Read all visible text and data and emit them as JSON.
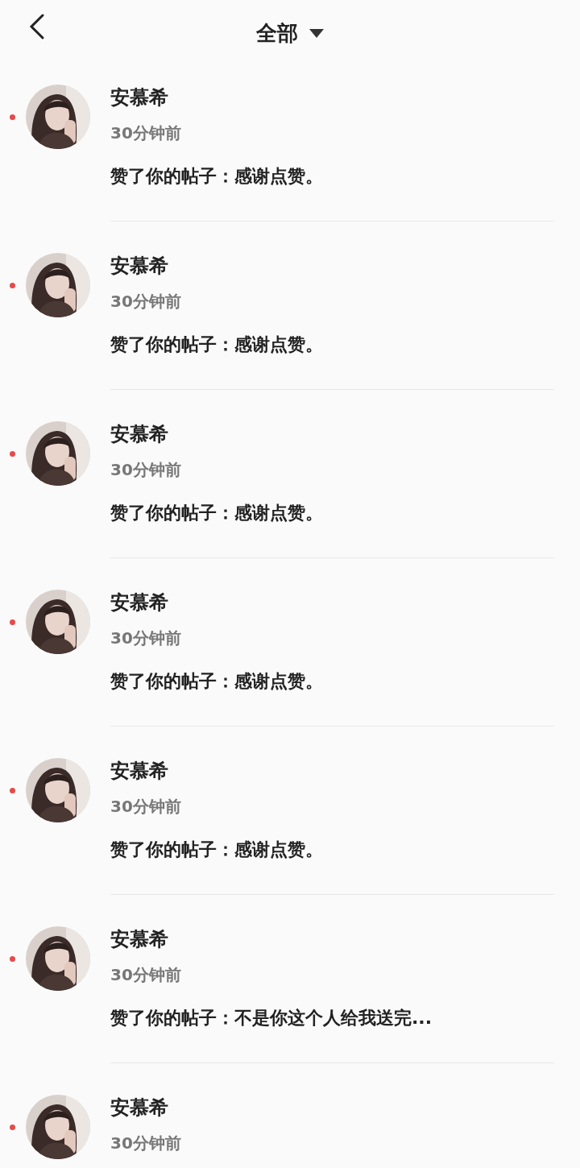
{
  "header": {
    "title": "全部"
  },
  "notifications": [
    {
      "name": "安慕希",
      "time": "30分钟前",
      "message": "赞了你的帖子：感谢点赞。",
      "unread": true
    },
    {
      "name": "安慕希",
      "time": "30分钟前",
      "message": "赞了你的帖子：感谢点赞。",
      "unread": true
    },
    {
      "name": "安慕希",
      "time": "30分钟前",
      "message": "赞了你的帖子：感谢点赞。",
      "unread": true
    },
    {
      "name": "安慕希",
      "time": "30分钟前",
      "message": "赞了你的帖子：感谢点赞。",
      "unread": true
    },
    {
      "name": "安慕希",
      "time": "30分钟前",
      "message": "赞了你的帖子：感谢点赞。",
      "unread": true
    },
    {
      "name": "安慕希",
      "time": "30分钟前",
      "message": "赞了你的帖子：不是你这个人给我送完...",
      "unread": true
    },
    {
      "name": "安慕希",
      "time": "30分钟前",
      "unread": true
    }
  ]
}
